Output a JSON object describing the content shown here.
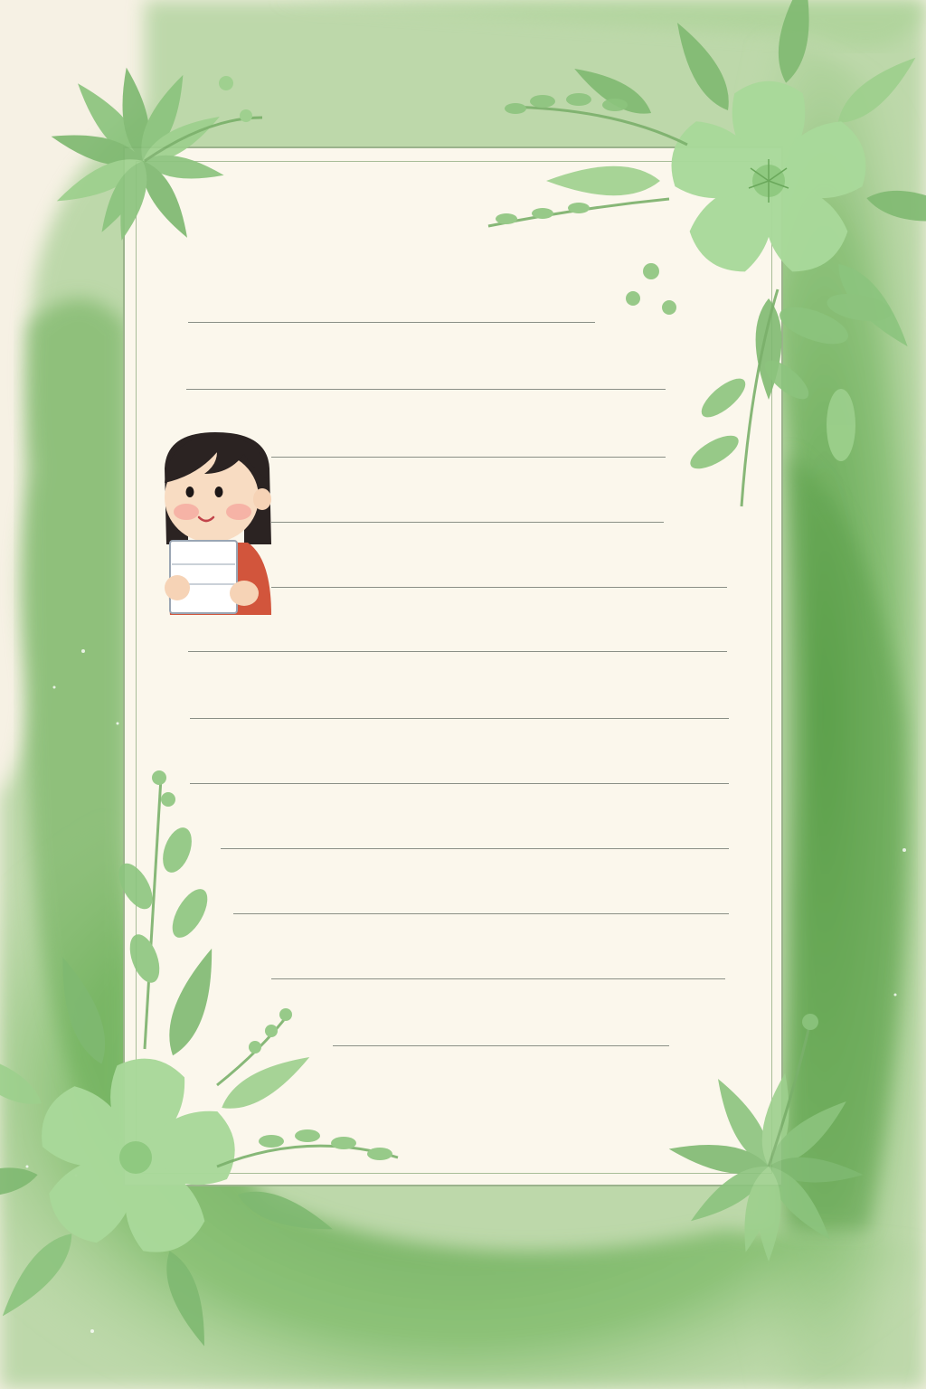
{
  "stationery": {
    "theme": "green watercolor floral writing paper",
    "line_count": 12
  },
  "colors": {
    "paper": "#fbf7ec",
    "frame": "#9bb38c",
    "ruled_line": "#8a8f86",
    "watercolor_green": "#6fae5f",
    "leaf_green": "#8cc47e"
  },
  "illustration": {
    "icon": "girl-holding-book-icon"
  }
}
